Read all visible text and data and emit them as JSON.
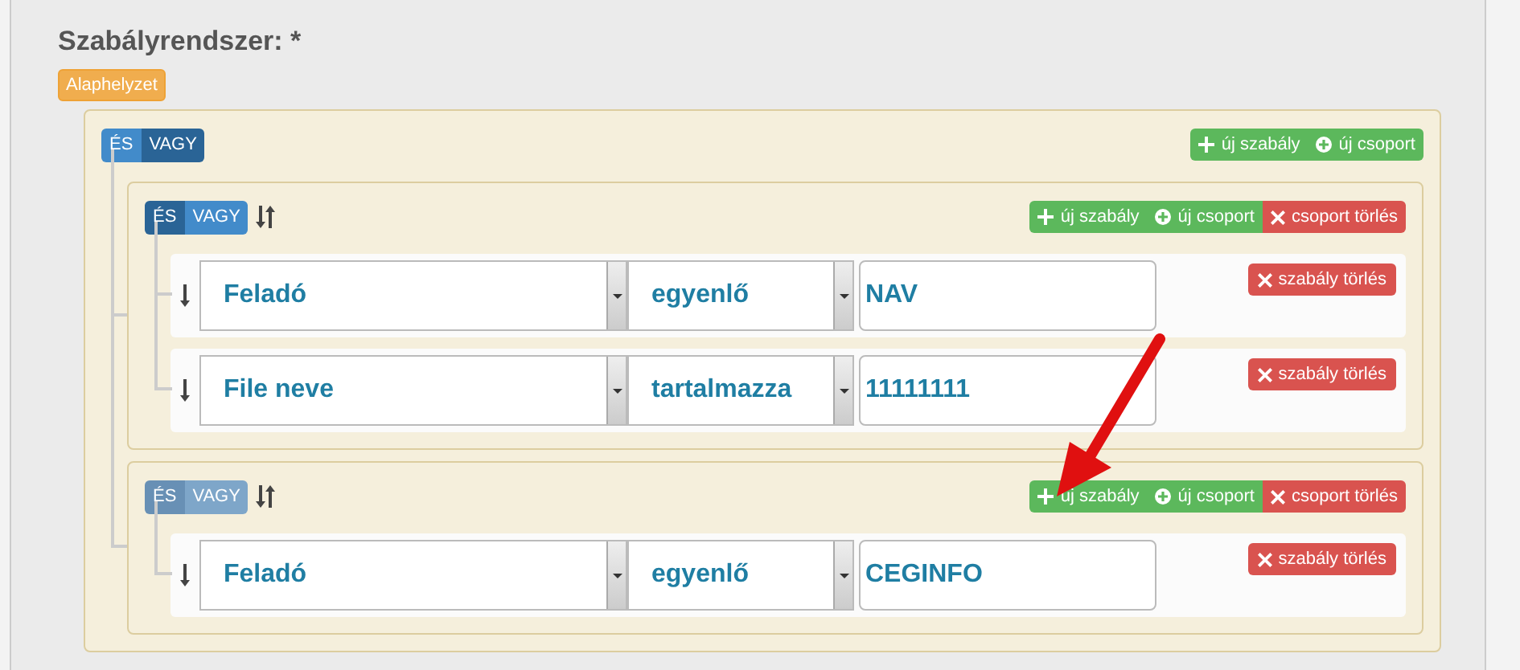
{
  "title": "Szabályrendszer: *",
  "reset_button": "Alaphelyzet",
  "root": {
    "kind": "group",
    "sortable": false,
    "disabled": false,
    "conditions": [
      {
        "label": "ÉS",
        "selected": false
      },
      {
        "label": "VAGY",
        "selected": true
      }
    ],
    "actions": [
      {
        "kind": "add-rule",
        "label": "új szabály"
      },
      {
        "kind": "add-group",
        "label": "új csoport"
      }
    ],
    "children": [
      {
        "kind": "group",
        "sortable": true,
        "disabled": false,
        "conditions": [
          {
            "label": "ÉS",
            "selected": true
          },
          {
            "label": "VAGY",
            "selected": false
          }
        ],
        "actions": [
          {
            "kind": "add-rule",
            "label": "új szabály"
          },
          {
            "kind": "add-group",
            "label": "új csoport"
          },
          {
            "kind": "delete-group",
            "label": "csoport törlés"
          }
        ],
        "children": [
          {
            "kind": "rule",
            "field": "Feladó",
            "operator": "egyenlő",
            "value": "NAV",
            "delete": "szabály törlés"
          },
          {
            "kind": "rule",
            "field": "File neve",
            "operator": "tartalmazza",
            "value": "11111111",
            "delete": "szabály törlés"
          }
        ]
      },
      {
        "kind": "group",
        "sortable": true,
        "disabled": true,
        "conditions": [
          {
            "label": "ÉS",
            "selected": true
          },
          {
            "label": "VAGY",
            "selected": false
          }
        ],
        "actions": [
          {
            "kind": "add-rule",
            "label": "új szabály"
          },
          {
            "kind": "add-group",
            "label": "új csoport"
          },
          {
            "kind": "delete-group",
            "label": "csoport törlés"
          }
        ],
        "children": [
          {
            "kind": "rule",
            "field": "Feladó",
            "operator": "egyenlő",
            "value": "CEGINFO",
            "delete": "szabály törlés"
          }
        ]
      }
    ]
  }
}
